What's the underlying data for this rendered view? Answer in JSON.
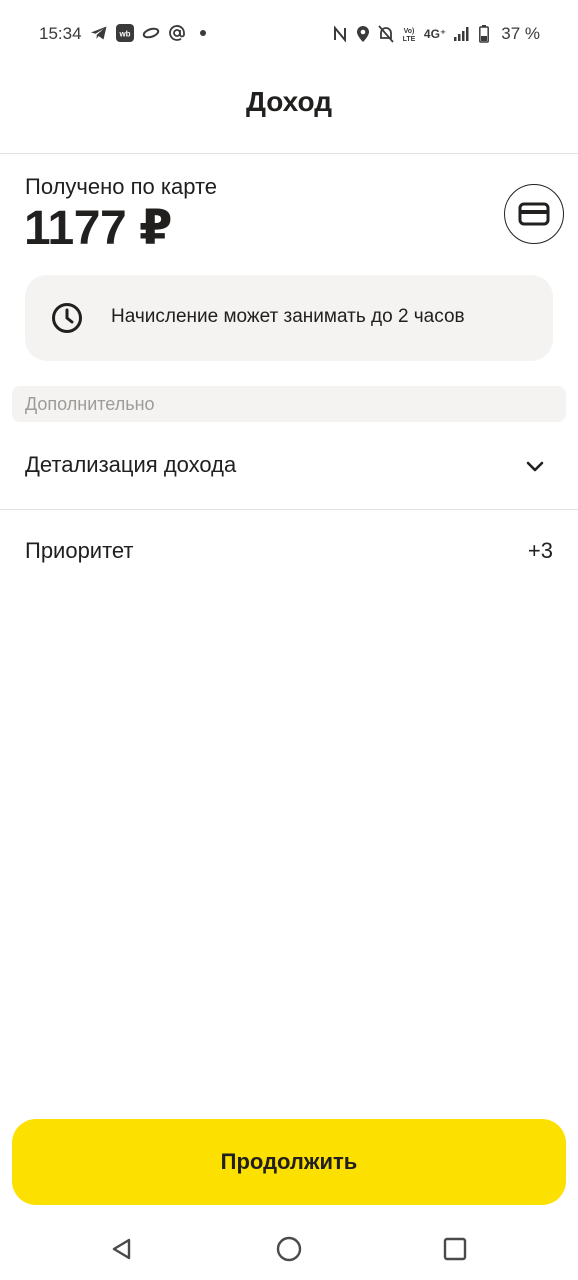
{
  "status_bar": {
    "time": "15:34",
    "left_icons": [
      "telegram-icon",
      "wb-icon",
      "ring-icon",
      "at-icon",
      "dot-icon"
    ],
    "network": "4G⁺",
    "volte": "VoLTE",
    "battery": "37 %"
  },
  "header": {
    "title": "Доход"
  },
  "income": {
    "label": "Получено по карте",
    "amount": "1177 ₽",
    "card_icon": "credit-card-icon"
  },
  "info": {
    "icon": "clock-icon",
    "text": "Начисление может занимать до 2 часов"
  },
  "section": {
    "title": "Дополнительно"
  },
  "rows": {
    "details": {
      "label": "Детализация дохода",
      "icon": "chevron-down-icon"
    },
    "priority": {
      "label": "Приоритет",
      "value": "+3"
    }
  },
  "footer": {
    "continue_label": "Продолжить"
  },
  "colors": {
    "accent": "#fce000",
    "text": "#21201f",
    "muted": "#9e9b98",
    "panel": "#f4f3f1"
  }
}
